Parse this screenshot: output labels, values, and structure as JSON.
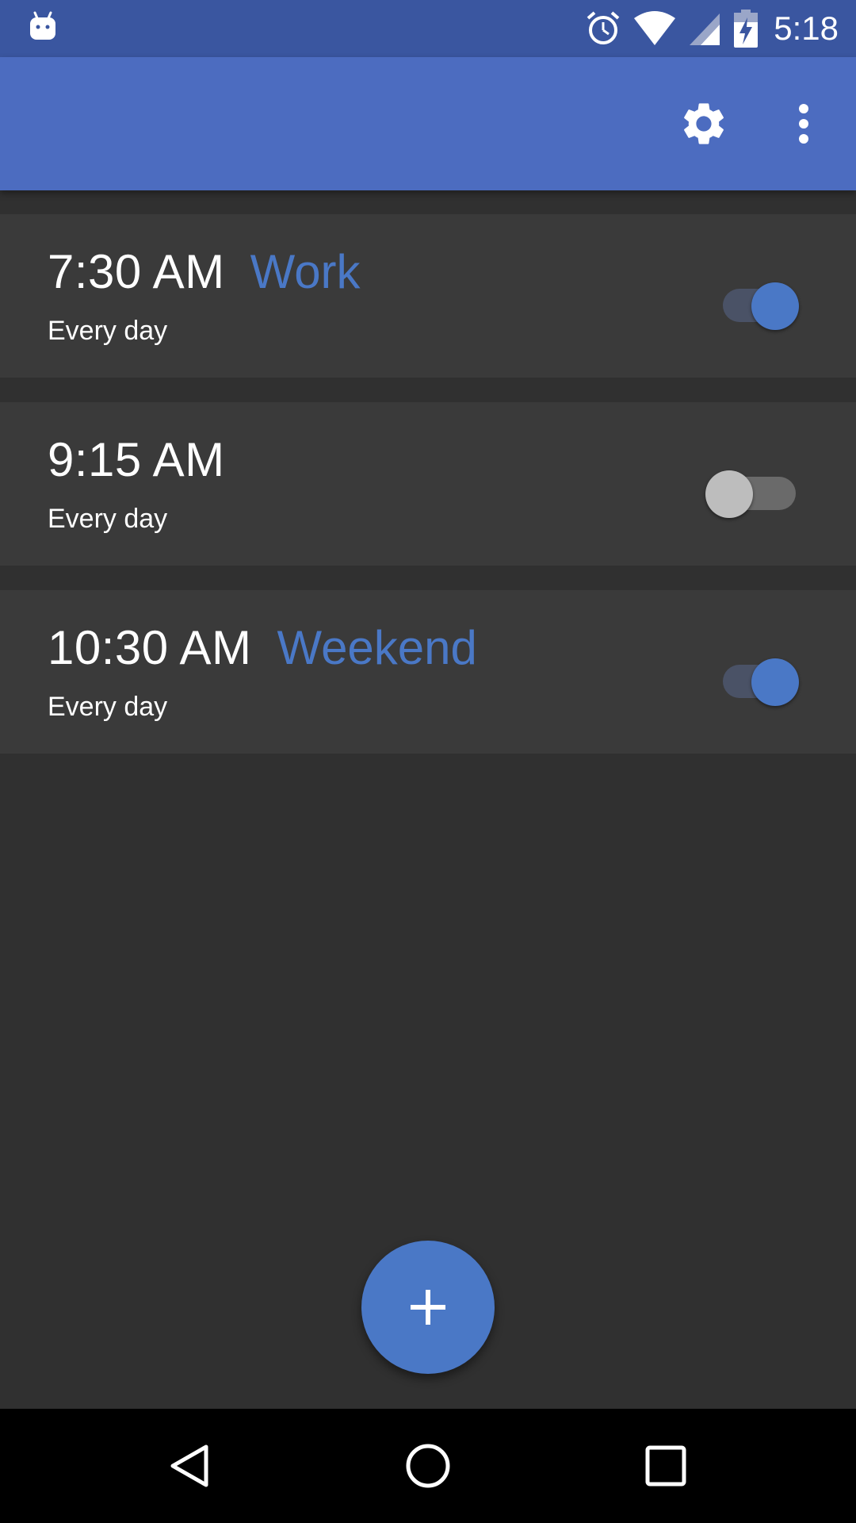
{
  "status_bar": {
    "time": "5:18",
    "icons": [
      "android-robot-icon",
      "alarm-clock-icon",
      "wifi-icon",
      "cell-signal-icon",
      "battery-charging-icon"
    ]
  },
  "app_bar": {
    "actions": [
      "settings-gear-icon",
      "more-vert-icon"
    ]
  },
  "alarms": [
    {
      "time": "7:30 AM",
      "label": "Work",
      "repeat": "Every day",
      "enabled": true
    },
    {
      "time": "9:15 AM",
      "label": "",
      "repeat": "Every day",
      "enabled": false
    },
    {
      "time": "10:30 AM",
      "label": "Weekend",
      "repeat": "Every day",
      "enabled": true
    }
  ],
  "fab": {
    "icon": "add-icon"
  },
  "nav_bar": {
    "buttons": [
      "back-icon",
      "home-icon",
      "recents-icon"
    ]
  },
  "colors": {
    "status_bar": "#3a56a0",
    "app_bar": "#4c6cc0",
    "background": "#303030",
    "card": "#3a3a3a",
    "accent": "#4a78c6"
  }
}
